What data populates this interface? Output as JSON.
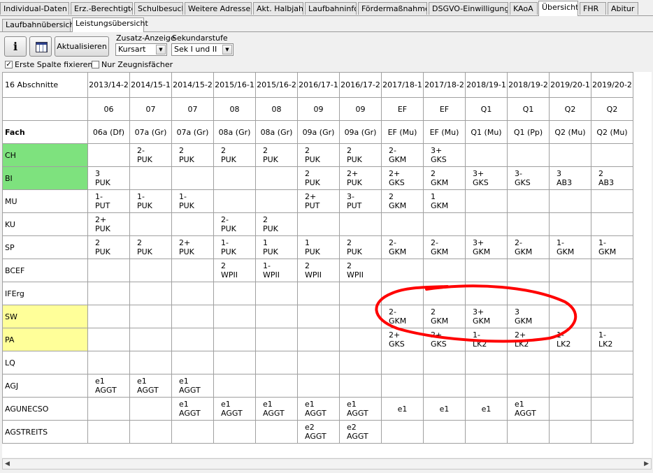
{
  "main_tabs": [
    {
      "label": "Individual-Daten II"
    },
    {
      "label": "Erz.-Berechtigte"
    },
    {
      "label": "Schulbesuch"
    },
    {
      "label": "Weitere Adressen"
    },
    {
      "label": "Akt. Halbjahr"
    },
    {
      "label": "Laufbahninfo"
    },
    {
      "label": "Fördermaßnahmen"
    },
    {
      "label": "DSGVO-Einwilligungen"
    },
    {
      "label": "KAoA"
    },
    {
      "label": "Übersicht"
    },
    {
      "label": "FHR"
    },
    {
      "label": "Abitur"
    }
  ],
  "sub_tabs": [
    {
      "label": "Laufbahnübersicht"
    },
    {
      "label": "Leistungsübersicht"
    }
  ],
  "toolbar": {
    "info_label": "i",
    "refresh_label": "Aktualisieren",
    "zusatz_label": "Zusatz-Anzeige",
    "zusatz_value": "Kursart",
    "stufe_label": "Sekundarstufe",
    "stufe_value": "Sek I und II",
    "fix_first_col_label": "Erste Spalte fixieren",
    "fix_first_col_checked": true,
    "only_report_label": "Nur Zeugnisfächer",
    "only_report_checked": false
  },
  "colors": {
    "green": "#7ee27e",
    "yellow": "#ffff99",
    "annotation": "#ff0000"
  },
  "table": {
    "corner_label": "16 Abschnitte",
    "fach_label": "Fach",
    "sections": [
      "2013/14-2",
      "2014/15-1",
      "2014/15-2",
      "2015/16-1",
      "2015/16-2",
      "2016/17-1",
      "2016/17-2",
      "2017/18-1",
      "2017/18-2",
      "2018/19-1",
      "2018/19-2",
      "2019/20-1",
      "2019/20-2"
    ],
    "jahrgang": [
      "06",
      "07",
      "07",
      "08",
      "08",
      "09",
      "09",
      "EF",
      "EF",
      "Q1",
      "Q1",
      "Q2",
      "Q2"
    ],
    "klassen": [
      "06a (Df)",
      "07a (Gr)",
      "07a (Gr)",
      "08a (Gr)",
      "08a (Gr)",
      "09a (Gr)",
      "09a (Gr)",
      "EF (Mu)",
      "EF (Mu)",
      "Q1 (Mu)",
      "Q1 (Pp)",
      "Q2 (Mu)",
      "Q2 (Mu)"
    ],
    "rows": [
      {
        "subject": "CH",
        "color": "green",
        "cells": [
          [
            "",
            ""
          ],
          [
            "2-",
            "PUK"
          ],
          [
            "2",
            "PUK"
          ],
          [
            "2",
            "PUK"
          ],
          [
            "2",
            "PUK"
          ],
          [
            "2",
            "PUK"
          ],
          [
            "2",
            "PUK"
          ],
          [
            "2-",
            "GKM"
          ],
          [
            "3+",
            "GKS"
          ],
          [
            "",
            ""
          ],
          [
            "",
            ""
          ],
          [
            "",
            ""
          ],
          [
            "",
            ""
          ]
        ]
      },
      {
        "subject": "BI",
        "color": "green",
        "cells": [
          [
            "3",
            "PUK"
          ],
          [
            "",
            ""
          ],
          [
            "",
            ""
          ],
          [
            "",
            ""
          ],
          [
            "",
            ""
          ],
          [
            "2",
            "PUK"
          ],
          [
            "2+",
            "PUK"
          ],
          [
            "2+",
            "GKS"
          ],
          [
            "2",
            "GKM"
          ],
          [
            "3+",
            "GKS"
          ],
          [
            "3-",
            "GKS"
          ],
          [
            "3",
            "AB3"
          ],
          [
            "2",
            "AB3"
          ]
        ]
      },
      {
        "subject": "MU",
        "color": "",
        "cells": [
          [
            "1-",
            "PUT"
          ],
          [
            "1-",
            "PUK"
          ],
          [
            "1-",
            "PUK"
          ],
          [
            "",
            ""
          ],
          [
            "",
            ""
          ],
          [
            "2+",
            "PUT"
          ],
          [
            "3-",
            "PUT"
          ],
          [
            "2",
            "GKM"
          ],
          [
            "1",
            "GKM"
          ],
          [
            "",
            ""
          ],
          [
            "",
            ""
          ],
          [
            "",
            ""
          ],
          [
            "",
            ""
          ]
        ]
      },
      {
        "subject": "KU",
        "color": "",
        "cells": [
          [
            "2+",
            "PUK"
          ],
          [
            "",
            ""
          ],
          [
            "",
            ""
          ],
          [
            "2-",
            "PUK"
          ],
          [
            "2",
            "PUK"
          ],
          [
            "",
            ""
          ],
          [
            "",
            ""
          ],
          [
            "",
            ""
          ],
          [
            "",
            ""
          ],
          [
            "",
            ""
          ],
          [
            "",
            ""
          ],
          [
            "",
            ""
          ],
          [
            "",
            ""
          ]
        ]
      },
      {
        "subject": "SP",
        "color": "",
        "cells": [
          [
            "2",
            "PUK"
          ],
          [
            "2",
            "PUK"
          ],
          [
            "2+",
            "PUK"
          ],
          [
            "1-",
            "PUK"
          ],
          [
            "1",
            "PUK"
          ],
          [
            "1",
            "PUK"
          ],
          [
            "2",
            "PUK"
          ],
          [
            "2-",
            "GKM"
          ],
          [
            "2-",
            "GKM"
          ],
          [
            "3+",
            "GKM"
          ],
          [
            "2-",
            "GKM"
          ],
          [
            "1-",
            "GKM"
          ],
          [
            "1-",
            "GKM"
          ]
        ]
      },
      {
        "subject": "BCEF",
        "color": "",
        "cells": [
          [
            "",
            ""
          ],
          [
            "",
            ""
          ],
          [
            "",
            ""
          ],
          [
            "2",
            "WPII"
          ],
          [
            "1-",
            "WPII"
          ],
          [
            "2",
            "WPII"
          ],
          [
            "2",
            "WPII"
          ],
          [
            "",
            ""
          ],
          [
            "",
            ""
          ],
          [
            "",
            ""
          ],
          [
            "",
            ""
          ],
          [
            "",
            ""
          ],
          [
            "",
            ""
          ]
        ]
      },
      {
        "subject": "IFErg",
        "color": "",
        "cells": [
          [
            "",
            ""
          ],
          [
            "",
            ""
          ],
          [
            "",
            ""
          ],
          [
            "",
            ""
          ],
          [
            "",
            ""
          ],
          [
            "",
            ""
          ],
          [
            "",
            ""
          ],
          [
            "",
            ""
          ],
          [
            "",
            ""
          ],
          [
            "",
            ""
          ],
          [
            "",
            ""
          ],
          [
            "",
            ""
          ],
          [
            "",
            ""
          ]
        ]
      },
      {
        "subject": "SW",
        "color": "yellow",
        "cells": [
          [
            "",
            ""
          ],
          [
            "",
            ""
          ],
          [
            "",
            ""
          ],
          [
            "",
            ""
          ],
          [
            "",
            ""
          ],
          [
            "",
            ""
          ],
          [
            "",
            ""
          ],
          [
            "2-",
            "GKM"
          ],
          [
            "2",
            "GKM"
          ],
          [
            "3+",
            "GKM"
          ],
          [
            "3",
            "GKM"
          ],
          [
            "",
            ""
          ],
          [
            "",
            ""
          ]
        ]
      },
      {
        "subject": "PA",
        "color": "yellow",
        "cells": [
          [
            "",
            ""
          ],
          [
            "",
            ""
          ],
          [
            "",
            ""
          ],
          [
            "",
            ""
          ],
          [
            "",
            ""
          ],
          [
            "",
            ""
          ],
          [
            "",
            ""
          ],
          [
            "2+",
            "GKS"
          ],
          [
            "2+",
            "GKS"
          ],
          [
            "1-",
            "LK2"
          ],
          [
            "2+",
            "LK2"
          ],
          [
            "1-",
            "LK2"
          ],
          [
            "1-",
            "LK2"
          ]
        ]
      },
      {
        "subject": "LQ",
        "color": "",
        "cells": [
          [
            "",
            ""
          ],
          [
            "",
            ""
          ],
          [
            "",
            ""
          ],
          [
            "",
            ""
          ],
          [
            "",
            ""
          ],
          [
            "",
            ""
          ],
          [
            "",
            ""
          ],
          [
            "",
            ""
          ],
          [
            "",
            ""
          ],
          [
            "",
            ""
          ],
          [
            "",
            ""
          ],
          [
            "",
            ""
          ],
          [
            "",
            ""
          ]
        ]
      },
      {
        "subject": "AGJ",
        "color": "",
        "cells": [
          [
            "e1",
            "AGGT"
          ],
          [
            "e1",
            "AGGT"
          ],
          [
            "e1",
            "AGGT"
          ],
          [
            "",
            ""
          ],
          [
            "",
            ""
          ],
          [
            "",
            ""
          ],
          [
            "",
            ""
          ],
          [
            "",
            ""
          ],
          [
            "",
            ""
          ],
          [
            "",
            ""
          ],
          [
            "",
            ""
          ],
          [
            "",
            ""
          ],
          [
            "",
            ""
          ]
        ]
      },
      {
        "subject": "AGUNECSO",
        "color": "",
        "cells": [
          [
            "",
            ""
          ],
          [
            "",
            ""
          ],
          [
            "e1",
            "AGGT"
          ],
          [
            "e1",
            "AGGT"
          ],
          [
            "e1",
            "AGGT"
          ],
          [
            "e1",
            "AGGT"
          ],
          [
            "e1",
            "AGGT"
          ],
          [
            "e1",
            ""
          ],
          [
            "e1",
            ""
          ],
          [
            "e1",
            ""
          ],
          [
            "e1",
            "AGGT"
          ],
          [
            "",
            ""
          ],
          [
            "",
            ""
          ]
        ]
      },
      {
        "subject": "AGSTREITS",
        "color": "",
        "cells": [
          [
            "",
            ""
          ],
          [
            "",
            ""
          ],
          [
            "",
            ""
          ],
          [
            "",
            ""
          ],
          [
            "",
            ""
          ],
          [
            "e2",
            "AGGT"
          ],
          [
            "e2",
            "AGGT"
          ],
          [
            "",
            ""
          ],
          [
            "",
            ""
          ],
          [
            "",
            ""
          ],
          [
            "",
            ""
          ],
          [
            "",
            ""
          ],
          [
            "",
            ""
          ]
        ]
      }
    ]
  }
}
